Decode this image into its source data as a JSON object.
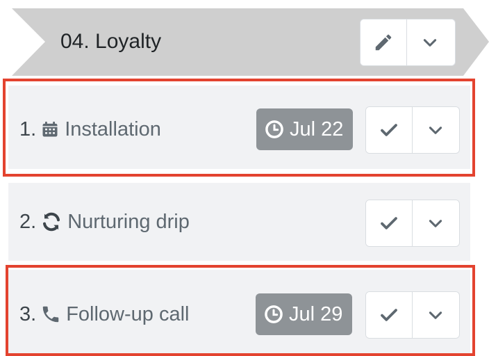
{
  "stage": {
    "title": "04. Loyalty",
    "edit_icon": "pencil-icon",
    "expand_icon": "chevron-down-icon"
  },
  "steps": [
    {
      "number": "1.",
      "icon": "calendar-icon",
      "label": "Installation",
      "due": "Jul 22",
      "highlighted": true
    },
    {
      "number": "2.",
      "icon": "sync-icon",
      "label": "Nurturing drip",
      "due": "",
      "highlighted": false
    },
    {
      "number": "3.",
      "icon": "phone-icon",
      "label": "Follow-up call",
      "due": "Jul 29",
      "highlighted": true
    }
  ],
  "colors": {
    "stage_bg": "#cfcfcf",
    "row_bg": "#f1f2f4",
    "badge_bg": "#8e9397",
    "highlight": "#e3432f",
    "icon": "#5e6870"
  }
}
